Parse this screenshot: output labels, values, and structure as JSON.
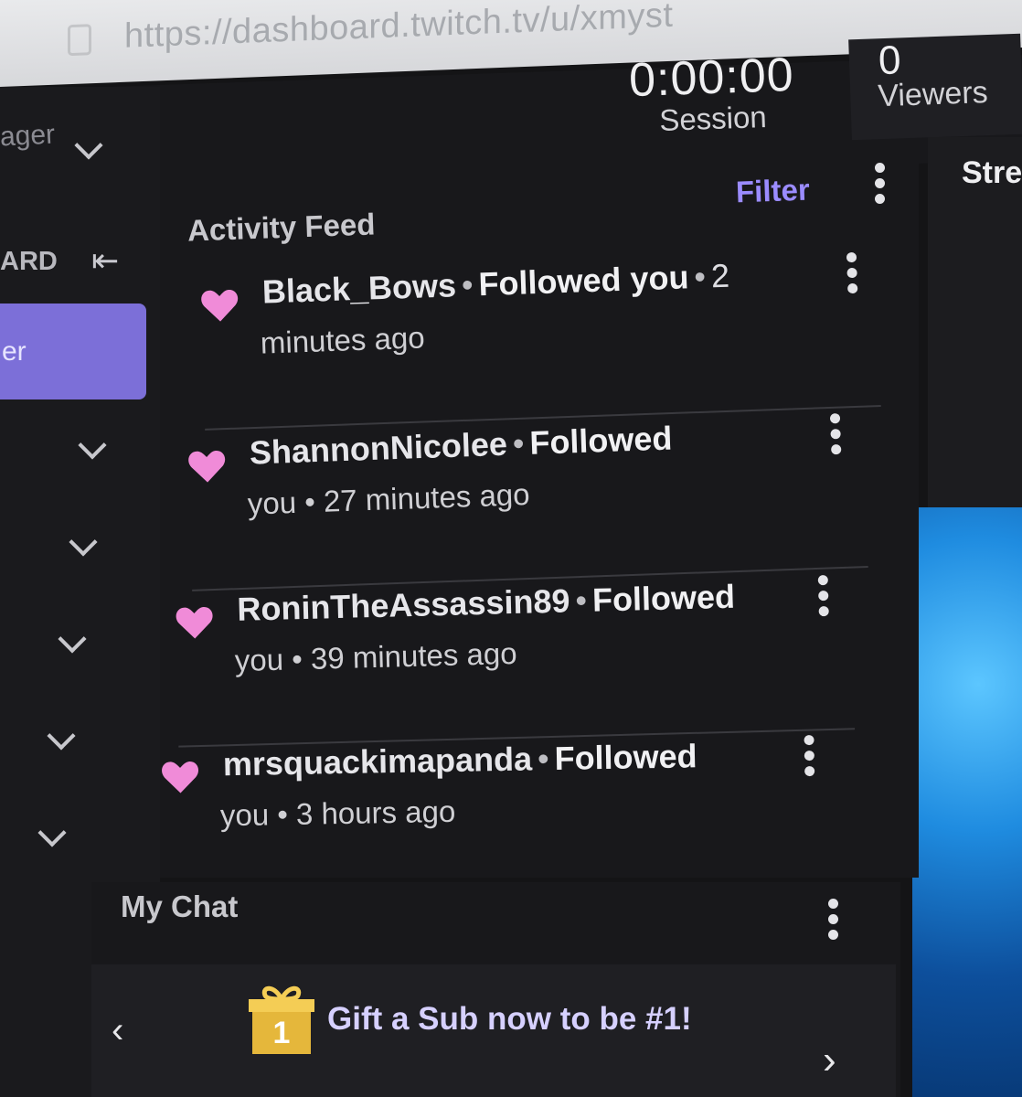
{
  "browser": {
    "url": "https://dashboard.twitch.tv/u/xmyst"
  },
  "stats": {
    "session_value": "0:00:00",
    "session_label": "Session",
    "viewers_value": "0",
    "viewers_label": "Viewers"
  },
  "leftnav": {
    "partial_label_top": "ager",
    "partial_label_dashboard": "ARD",
    "active_partial_label": "er"
  },
  "activity_feed": {
    "title": "Activity Feed",
    "filter_label": "Filter",
    "items": [
      {
        "user": "Black_Bows",
        "action": "Followed you",
        "line1_tail": "2",
        "line2": "minutes ago"
      },
      {
        "user": "ShannonNicolee",
        "action": "Followed",
        "line1_tail": "",
        "line2": "you • 27 minutes ago"
      },
      {
        "user": "RoninTheAssassin89",
        "action": "Followed",
        "line1_tail": "",
        "line2": "you • 39 minutes ago"
      },
      {
        "user": "mrsquackimapanda",
        "action": "Followed",
        "line1_tail": "",
        "line2": "you • 3 hours ago"
      }
    ]
  },
  "right_panel": {
    "partial_title": "Stre"
  },
  "chat": {
    "title": "My Chat",
    "gift_text": "Gift a Sub now to be #1!",
    "gift_number": "1"
  },
  "colors": {
    "accent": "#9b8cff",
    "active_nav": "#7c6fd8",
    "heart": "#f08bd8",
    "background": "#18181b"
  }
}
